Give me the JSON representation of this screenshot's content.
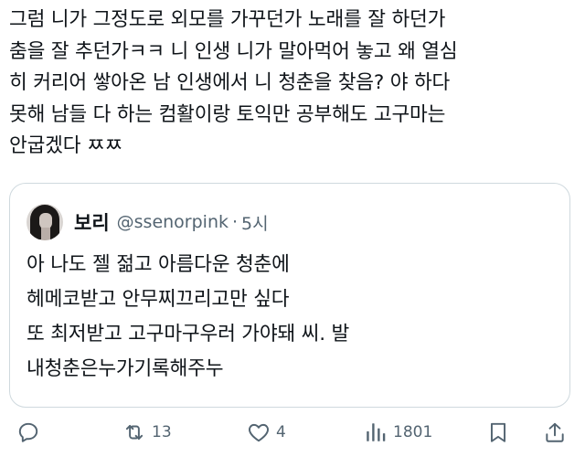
{
  "tweet": {
    "text_lines": [
      "그럼 니가 그정도로 외모를 가꾸던가 노래를 잘 하던가",
      "춤을 잘 추던가ㅋㅋ 니 인생 니가 말아먹어 놓고 왜 열심",
      "히 커리어 쌓아온 남 인생에서 니 청춘을 찾음? 야 하다",
      "못해 남들 다 하는 컴활이랑 토익만 공부해도 고구마는",
      "안굽겠다 ㅉㅉ"
    ]
  },
  "quoted_tweet": {
    "display_name": "보리",
    "handle": "@ssenorpink",
    "separator": "·",
    "time": "5시",
    "text_lines": [
      "아 나도 젤 젊고 아름다운 청춘에",
      "헤메코받고 안무찌끄리고만 싶다",
      "또 최저받고 고구마구우러 가야돼 씨. 발",
      "내청춘은누가기록해주누"
    ]
  },
  "actions": {
    "reply": {
      "icon": "reply-icon"
    },
    "retweet": {
      "icon": "retweet-icon",
      "count": "13"
    },
    "like": {
      "icon": "heart-icon",
      "count": "4"
    },
    "views": {
      "icon": "views-icon",
      "count": "1801"
    },
    "bookmark": {
      "icon": "bookmark-icon"
    },
    "share": {
      "icon": "share-icon"
    }
  },
  "colors": {
    "text": "#0f1419",
    "secondary": "#536471",
    "border": "#cfd9de"
  }
}
